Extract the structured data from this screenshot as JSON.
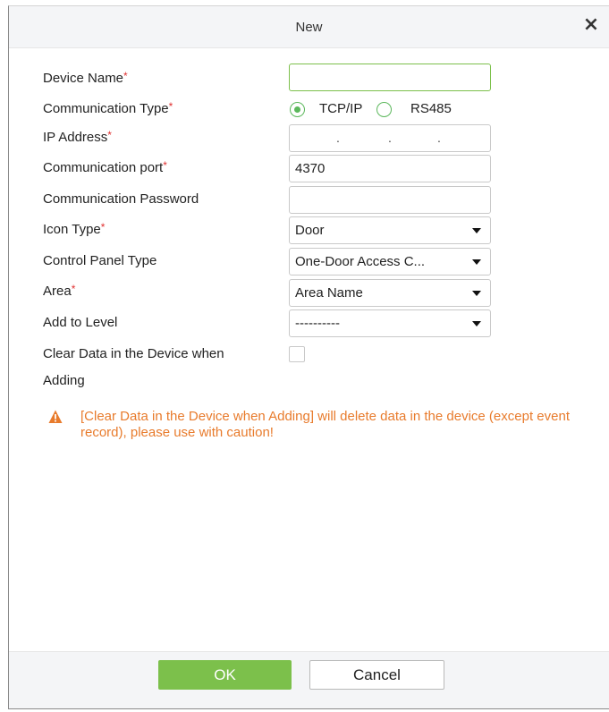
{
  "dialog": {
    "title": "New",
    "close_icon": "close-icon"
  },
  "form": {
    "device_name": {
      "label": "Device Name",
      "required": "*",
      "value": ""
    },
    "communication_type": {
      "label": "Communication Type",
      "required": "*",
      "options": [
        {
          "label": "TCP/IP",
          "checked": true
        },
        {
          "label": "RS485",
          "checked": false
        }
      ]
    },
    "ip_address": {
      "label": "IP Address",
      "required": "*",
      "value": ""
    },
    "communication_port": {
      "label": "Communication port",
      "required": "*",
      "value": "4370"
    },
    "communication_password": {
      "label": "Communication Password",
      "value": ""
    },
    "icon_type": {
      "label": "Icon Type",
      "required": "*",
      "value": "Door"
    },
    "control_panel_type": {
      "label": "Control Panel Type",
      "value": "One-Door Access C..."
    },
    "area": {
      "label": "Area",
      "required": "*",
      "value": "Area Name"
    },
    "add_to_level": {
      "label": "Add to Level",
      "value": "----------"
    },
    "clear_data": {
      "label_line1": "Clear Data in the Device when",
      "label_line2": "Adding",
      "checked": false
    }
  },
  "warning": {
    "icon": "warning-icon",
    "color": "#e87b2c",
    "text": "[Clear Data in the Device when Adding] will delete data in the device (except event record), please use with caution!"
  },
  "buttons": {
    "ok_label": "OK",
    "cancel_label": "Cancel"
  },
  "colors": {
    "accent": "#7cc04b",
    "required": "#e03030",
    "warning": "#e87b2c"
  }
}
